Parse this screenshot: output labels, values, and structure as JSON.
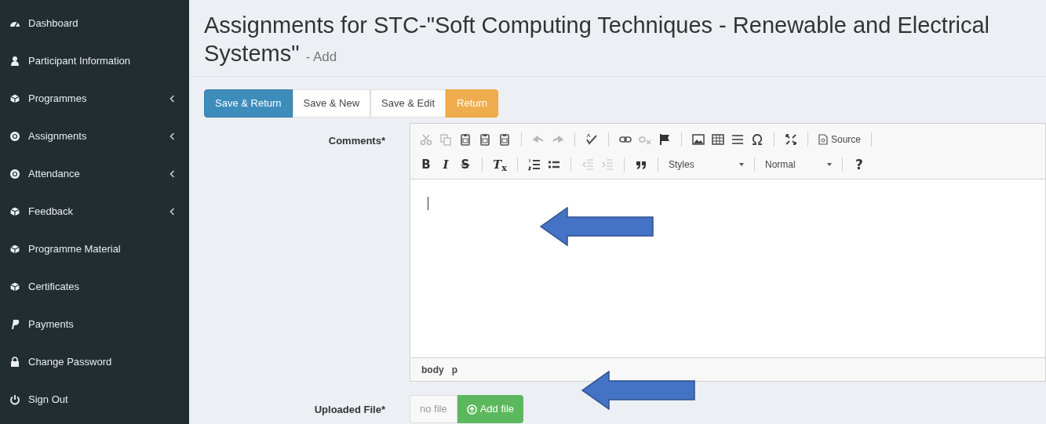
{
  "sidebar": {
    "items": [
      {
        "label": "Dashboard",
        "expandable": false
      },
      {
        "label": "Participant Information",
        "expandable": false
      },
      {
        "label": "Programmes",
        "expandable": true
      },
      {
        "label": "Assignments",
        "expandable": true
      },
      {
        "label": "Attendance",
        "expandable": true
      },
      {
        "label": "Feedback",
        "expandable": true
      },
      {
        "label": "Programme Material",
        "expandable": false
      },
      {
        "label": "Certificates",
        "expandable": false
      },
      {
        "label": "Payments",
        "expandable": false
      },
      {
        "label": "Change Password",
        "expandable": false
      },
      {
        "label": "Sign Out",
        "expandable": false
      }
    ]
  },
  "page": {
    "title": "Assignments for STC-\"Soft Computing Techniques - Renewable and Electrical Systems\"",
    "subtitle": "- Add"
  },
  "buttons": [
    {
      "label": "Save & Return",
      "kind": "primary"
    },
    {
      "label": "Save & New",
      "kind": "default"
    },
    {
      "label": "Save & Edit",
      "kind": "default"
    },
    {
      "label": "Return",
      "kind": "warning"
    }
  ],
  "form": {
    "comments": {
      "label": "Comments*",
      "toolbar": {
        "source": "Source",
        "bold": "B",
        "italic": "I",
        "strike": "S",
        "clear_format": "*T*$_{x}$",
        "styles": "Styles",
        "format": "Normal",
        "help": "?"
      },
      "path": [
        "body",
        "p"
      ]
    },
    "upload": {
      "label": "Uploaded File*",
      "value": "no file",
      "button": "Add file"
    }
  }
}
